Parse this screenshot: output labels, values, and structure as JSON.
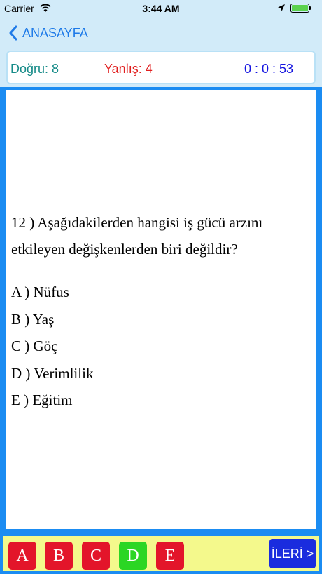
{
  "status_bar": {
    "carrier": "Carrier",
    "time": "3:44 AM",
    "battery_level": 1.0
  },
  "nav": {
    "back_label": "ANASAYFA"
  },
  "score": {
    "correct_label": "Doğru: 8",
    "wrong_label": "Yanlış: 4",
    "timer": "0 : 0 : 53"
  },
  "question": {
    "text": "12 ) Aşağıdakilerden hangisi iş gücü arzını etkileyen değişkenlerden biri değildir?",
    "options": [
      "A ) Nüfus",
      "B ) Yaş",
      "C ) Göç",
      "D ) Verimlilik",
      "E ) Eğitim"
    ]
  },
  "answer_bar": {
    "buttons": [
      {
        "label": "A",
        "color": "#e3152a"
      },
      {
        "label": "B",
        "color": "#e3152a"
      },
      {
        "label": "C",
        "color": "#e3152a"
      },
      {
        "label": "D",
        "color": "#2bd624"
      },
      {
        "label": "E",
        "color": "#e3152a"
      }
    ],
    "next_label": "İLERİ >"
  },
  "colors": {
    "accent": "#1e7ae8",
    "frame": "#1b8cf2",
    "correct": "#168b88",
    "wrong": "#e11f1f",
    "timer": "#1414e0",
    "answer_bar_bg": "#f4f98c",
    "next_button": "#1a2cde"
  }
}
